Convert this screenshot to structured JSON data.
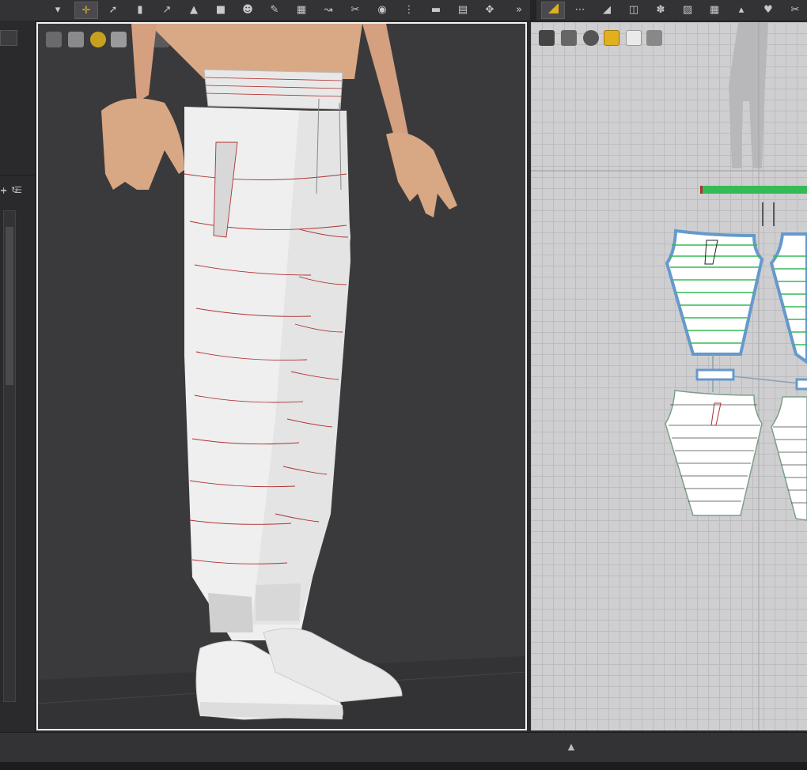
{
  "app": {
    "top_toolbar": {
      "left_group": [
        "move-icon",
        "transform-pattern-icon",
        "edit-point-icon",
        "garment-icon",
        "segment-icon",
        "fold-icon",
        "tack-icon",
        "avatar-icon",
        "pin-icon",
        "mesh-icon",
        "select-icon",
        "sewing-icon",
        "fitting-icon",
        "zipper-icon",
        "elastic-icon",
        "measure-icon",
        "arrange-icon"
      ],
      "right_group": [
        "select-pattern-icon",
        "edit-curve-icon",
        "polygon-icon",
        "rectangle-icon",
        "trace-icon",
        "internal-icon",
        "dart-icon",
        "grid-icon",
        "hanger-icon",
        "fabric-icon",
        "seam-icon"
      ],
      "overflow_label": "»"
    },
    "viewport3d": {
      "toolbar_icons": [
        "display-garment-icon",
        "shirt-icon",
        "pattern-color-icon",
        "avatar-display-icon",
        "texture-icon",
        "shading-icon",
        "skin-icon",
        "globe-icon",
        "export-icon"
      ]
    },
    "viewport2d": {
      "toolbar_icons": [
        "brush-icon",
        "shirt-icon",
        "info-icon",
        "highlight-icon",
        "lock-shirt-icon",
        "export-icon"
      ]
    },
    "bottom_bar": {
      "expand_label": "▲"
    },
    "left_panel": {
      "add_label": "+",
      "refresh_label": "↻",
      "list_label": "☰"
    },
    "colors": {
      "accent": "#e0b020",
      "selected_pattern": "#6699cc",
      "green_bar": "#33bb55",
      "seam_red": "#b03030"
    }
  }
}
